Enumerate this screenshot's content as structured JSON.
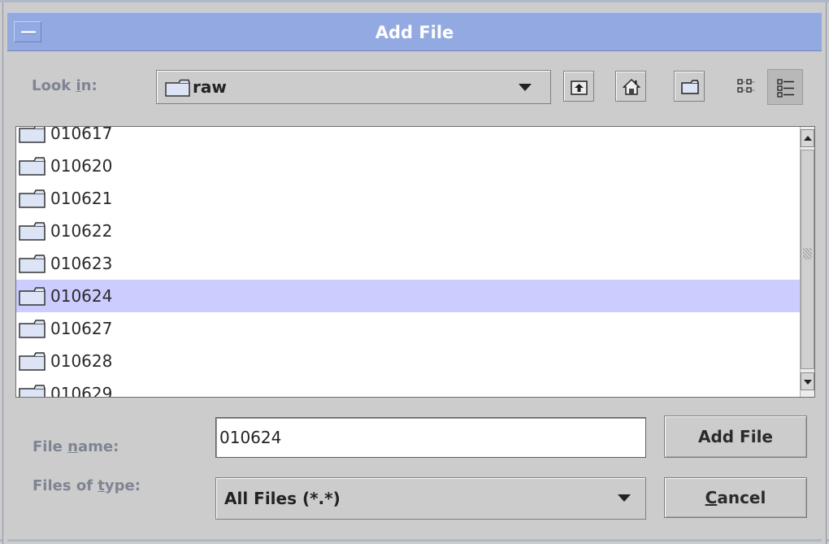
{
  "window": {
    "title": "Add File"
  },
  "lookin": {
    "label_pre": "Look ",
    "label_key": "i",
    "label_post": "n:",
    "value": "raw"
  },
  "toolbar": {
    "up": "up-folder-icon",
    "home": "home-icon",
    "newfolder": "new-folder-icon",
    "list_view": "list-view-icon",
    "details_view": "details-view-icon"
  },
  "files": [
    {
      "name": "010617",
      "selected": false
    },
    {
      "name": "010620",
      "selected": false
    },
    {
      "name": "010621",
      "selected": false
    },
    {
      "name": "010622",
      "selected": false
    },
    {
      "name": "010623",
      "selected": false
    },
    {
      "name": "010624",
      "selected": true
    },
    {
      "name": "010627",
      "selected": false
    },
    {
      "name": "010628",
      "selected": false
    },
    {
      "name": "010629",
      "selected": false
    }
  ],
  "filename": {
    "label_pre": "File ",
    "label_key": "n",
    "label_post": "ame:",
    "value": "010624"
  },
  "filetype": {
    "label_pre": "Files of ",
    "label_key": "t",
    "label_post": "ype:",
    "value": "All Files (*.*)"
  },
  "buttons": {
    "approve": "Add File",
    "cancel_key": "C",
    "cancel_rest": "ancel"
  },
  "colors": {
    "title_bar": "#93a9e2",
    "selection": "#ccccff",
    "background": "#cccccc"
  }
}
